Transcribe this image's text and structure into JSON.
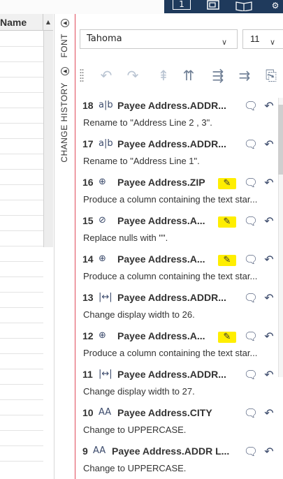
{
  "topbar": {
    "icons": [
      "layer-1-icon",
      "window-icon",
      "book-icon",
      "gear-icon"
    ],
    "labels": [
      "1",
      "",
      "",
      ""
    ]
  },
  "grid": {
    "header": "Name"
  },
  "side_tabs": {
    "font": "FONT",
    "history": "CHANGE HISTORY"
  },
  "toolbar": {
    "font_name": "Tahoma",
    "font_size": "11"
  },
  "history": [
    {
      "num": "18",
      "kind": "a|b",
      "target": "Payee Address.ADDR...",
      "desc": "Rename to \"Address Line 2 , 3\".",
      "edit": false
    },
    {
      "num": "17",
      "kind": "a|b",
      "target": "Payee Address.ADDR...",
      "desc": "Rename to \"Address Line 1\".",
      "edit": false
    },
    {
      "num": "16",
      "kind": "⊕",
      "target": "Payee Address.ZIP",
      "desc": "Produce a column containing the text star...",
      "edit": true
    },
    {
      "num": "15",
      "kind": "⊘",
      "target": "Payee Address.A...",
      "desc": "Replace nulls with \"\".",
      "edit": true
    },
    {
      "num": "14",
      "kind": "⊕",
      "target": "Payee Address.A...",
      "desc": "Produce a column containing the text star...",
      "edit": true
    },
    {
      "num": "13",
      "kind": "|↔|",
      "target": "Payee Address.ADDR...",
      "desc": "Change display width to 26.",
      "edit": false
    },
    {
      "num": "12",
      "kind": "⊕",
      "target": "Payee Address.A...",
      "desc": "Produce a column containing the text star...",
      "edit": true
    },
    {
      "num": "11",
      "kind": "|↔|",
      "target": "Payee Address.ADDR...",
      "desc": "Change display width to 27.",
      "edit": false
    },
    {
      "num": "10",
      "kind": "AA",
      "target": "Payee Address.CITY",
      "desc": "Change to UPPERCASE.",
      "edit": false
    },
    {
      "num": "9",
      "kind": "AA",
      "target": "Payee Address.ADDR L...",
      "desc": "Change to UPPERCASE.",
      "edit": false
    }
  ]
}
